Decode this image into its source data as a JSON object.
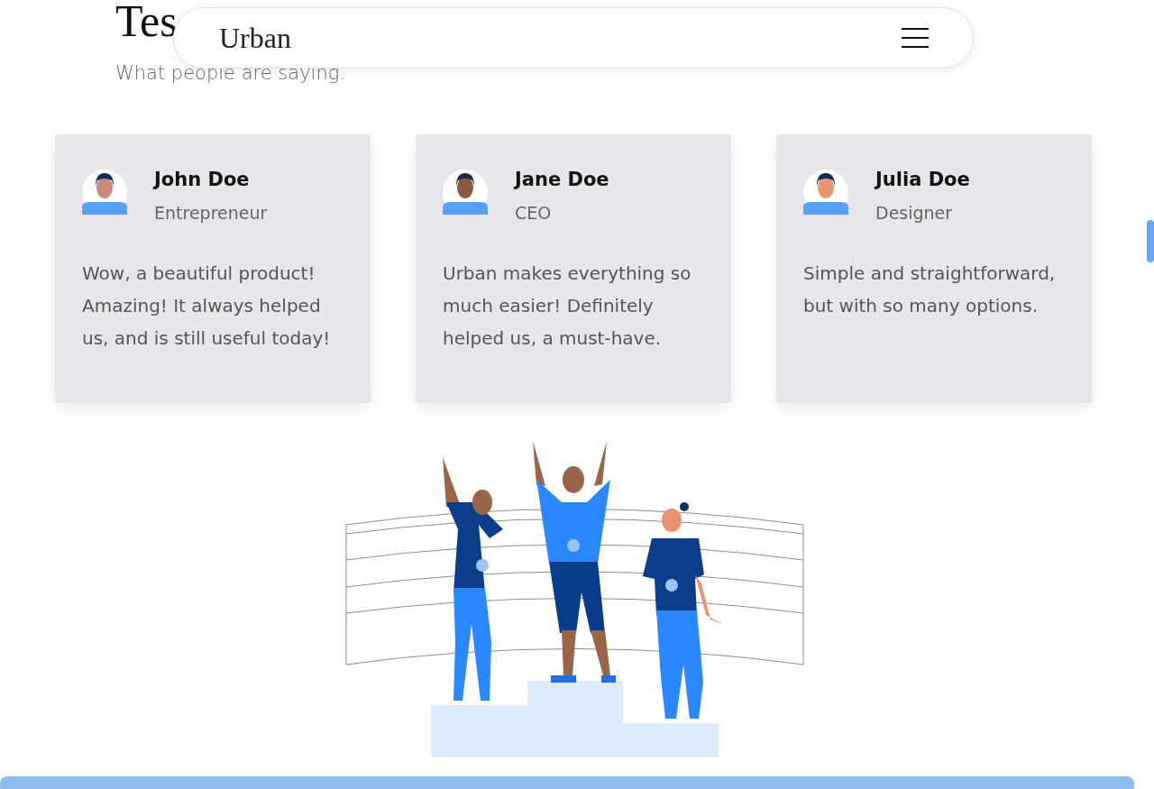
{
  "nav": {
    "logo": "Urban"
  },
  "heading": "Tes",
  "subtitle": "What people are saying.",
  "testimonials": [
    {
      "name": "John Doe",
      "role": "Entrepreneur",
      "quote": "Wow, a beautiful product! Amazing! It always helped us, and is still useful today!"
    },
    {
      "name": "Jane Doe",
      "role": "CEO",
      "quote": "Urban makes everything so much easier! Definitely helped us, a must-have."
    },
    {
      "name": "Julia Doe",
      "role": "Designer",
      "quote": "Simple and straightforward, but with so many options."
    }
  ]
}
